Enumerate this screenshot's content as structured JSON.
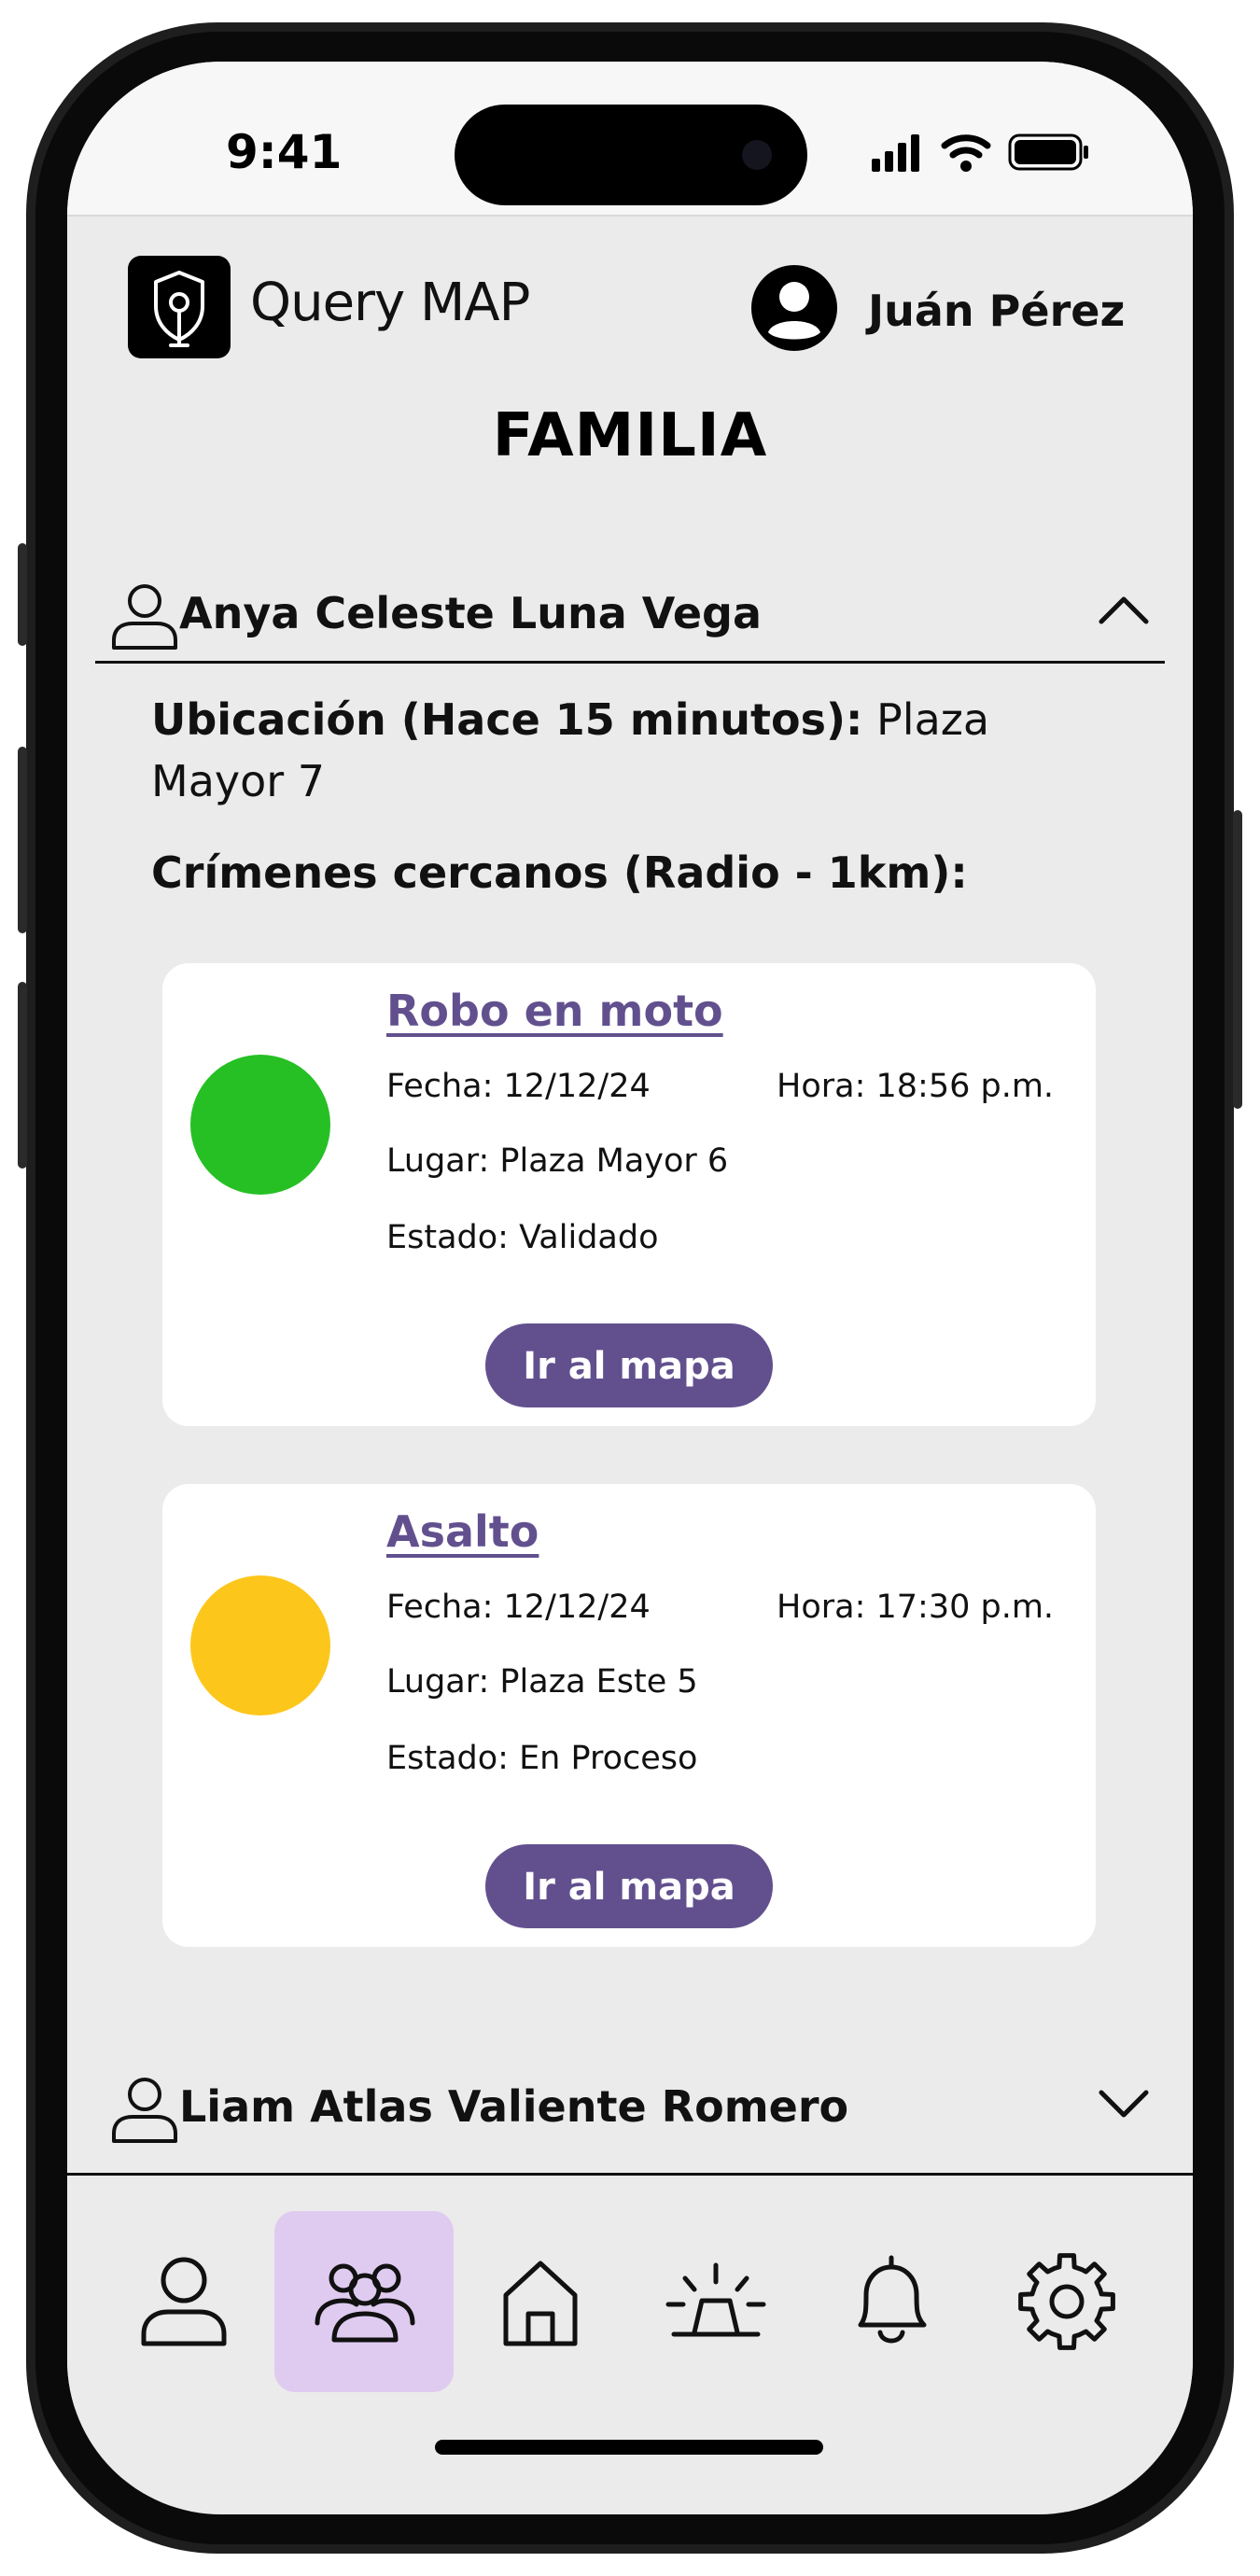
{
  "status_bar": {
    "time": "9:41"
  },
  "app": {
    "name": "Query MAP",
    "user": "Juán Pérez"
  },
  "page": {
    "title": "FAMILIA"
  },
  "members": [
    {
      "name": "Anya Celeste Luna Vega",
      "expanded": true,
      "location_label": "Ubicación (Hace 15 minutos):",
      "location_value": "Plaza Mayor 7",
      "crimes_label": "Crímenes cercanos (Radio - 1km):",
      "crimes": [
        {
          "title": "Robo en moto",
          "fecha": "Fecha: 12/12/24",
          "hora": "Hora: 18:56 p.m.",
          "lugar": "Lugar: Plaza Mayor 6",
          "estado": "Estado: Validado",
          "status_color": "#26c024",
          "button": "Ir al mapa"
        },
        {
          "title": "Asalto",
          "fecha": "Fecha: 12/12/24",
          "hora": "Hora: 17:30 p.m.",
          "lugar": "Lugar: Plaza Este 5",
          "estado": "Estado: En Proceso",
          "status_color": "#fdc61b",
          "button": "Ir al mapa"
        }
      ]
    },
    {
      "name": "Liam Atlas Valiente Romero",
      "expanded": false
    }
  ],
  "nav": [
    {
      "icon": "user-icon",
      "active": false
    },
    {
      "icon": "family-icon",
      "active": true
    },
    {
      "icon": "home-icon",
      "active": false
    },
    {
      "icon": "alarm-icon",
      "active": false
    },
    {
      "icon": "bell-icon",
      "active": false
    },
    {
      "icon": "gear-icon",
      "active": false
    }
  ],
  "colors": {
    "accent": "#62508e",
    "active_nav": "#dfcbf0",
    "background": "#ebebeb"
  }
}
